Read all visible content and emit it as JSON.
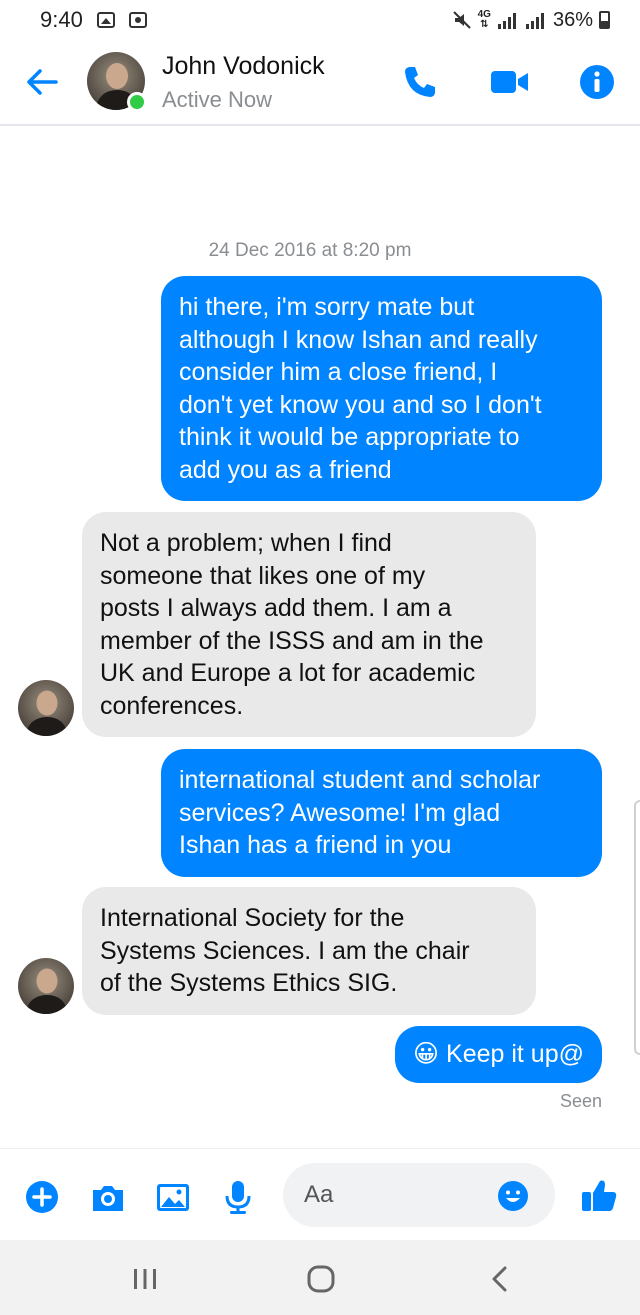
{
  "status_bar": {
    "time": "9:40",
    "network": "4G",
    "battery": "36%",
    "icons": [
      "image-icon",
      "notification-icon",
      "mute-icon",
      "signal-icon",
      "signal-icon",
      "battery-icon"
    ]
  },
  "header": {
    "contact_name": "John Vodonick",
    "status": "Active Now",
    "icons": [
      "back-arrow-icon",
      "phone-icon",
      "video-camera-icon",
      "info-icon"
    ]
  },
  "conversation": {
    "timestamp": "24 Dec 2016 at 8:20 pm",
    "messages": [
      {
        "from": "me",
        "lines": [
          "hi there, i'm sorry mate but",
          "although I know Ishan and really",
          "consider him a close friend, I",
          "don't yet know you and so I don't",
          "think it would be appropriate to",
          "add you as a friend"
        ]
      },
      {
        "from": "contact",
        "lines": [
          "Not a problem; when I find",
          "someone that likes one of my",
          "posts I always add them. I am a",
          "member of the ISSS and am in the",
          "UK and Europe a lot for academic",
          "conferences."
        ]
      },
      {
        "from": "me",
        "lines": [
          "international student and scholar",
          "services? Awesome! I'm glad",
          "Ishan has a friend in you"
        ]
      },
      {
        "from": "contact",
        "lines": [
          "International Society for the",
          "Systems Sciences. I am the chair",
          "of the Systems Ethics SIG."
        ]
      },
      {
        "from": "me",
        "lines": [
          "😀 Keep it up@"
        ]
      }
    ],
    "seen_label": "Seen"
  },
  "composer": {
    "placeholder": "Aa",
    "icons": [
      "plus-icon",
      "camera-icon",
      "gallery-icon",
      "microphone-icon",
      "emoji-icon",
      "thumbs-up-icon"
    ]
  },
  "navbar": {
    "icons": [
      "recent-apps-icon",
      "home-icon",
      "back-icon"
    ]
  },
  "colors": {
    "accent": "#0084ff",
    "incoming_bubble": "#e9e9e9",
    "online": "#31cc46",
    "secondary_text": "#8a8d91"
  }
}
